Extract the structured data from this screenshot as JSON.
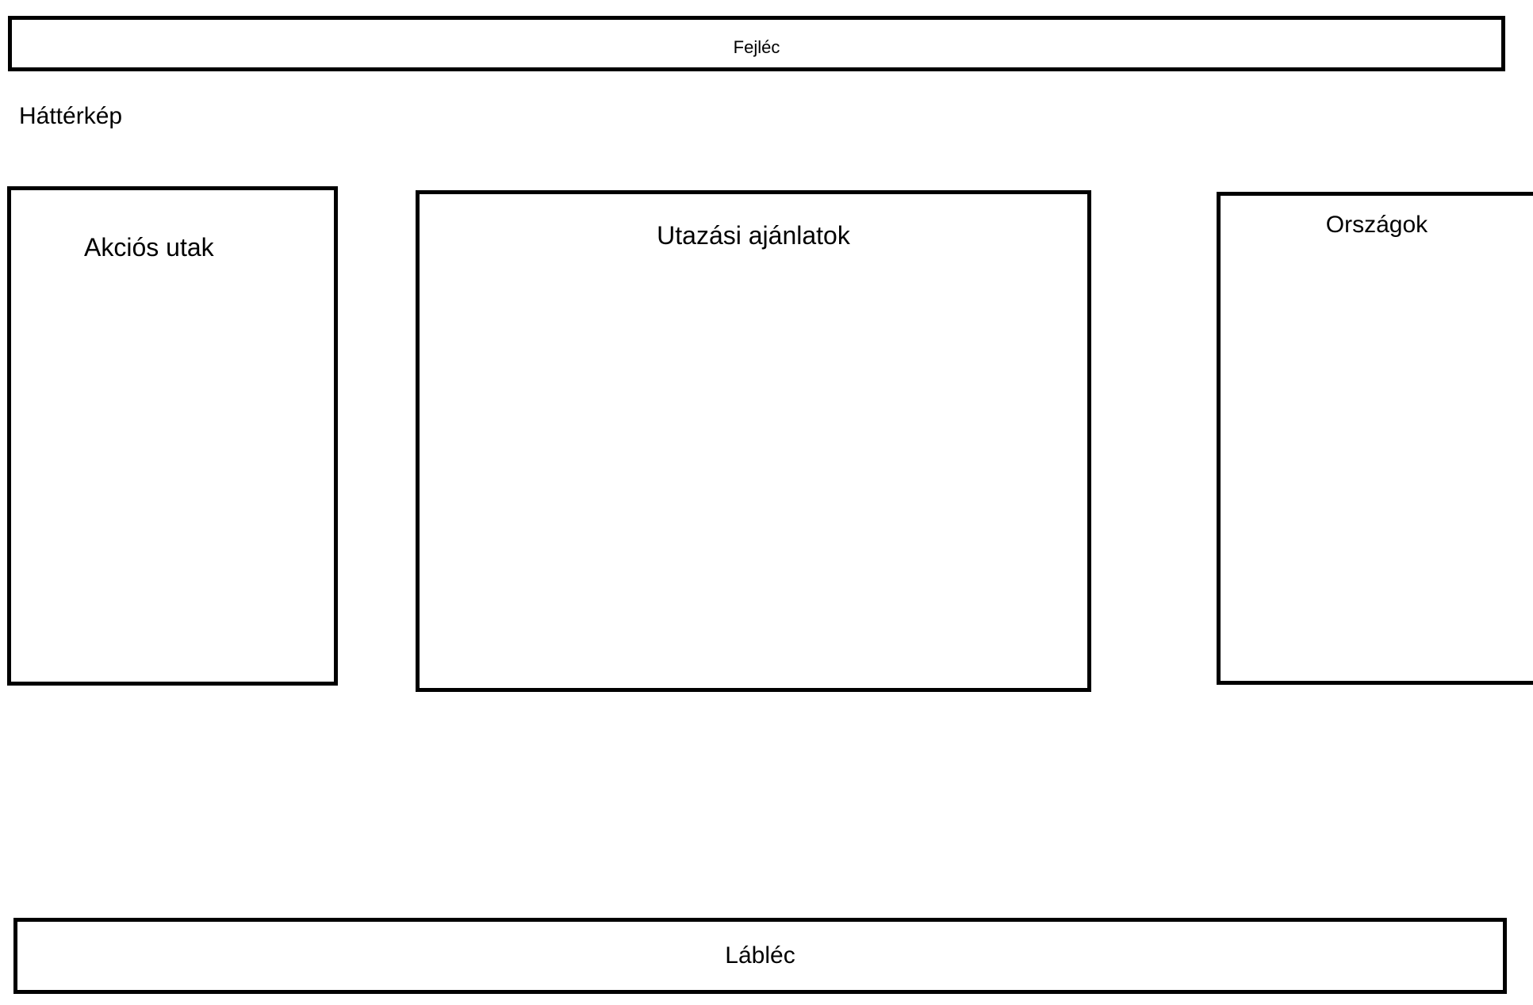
{
  "header": {
    "label": "Fejléc"
  },
  "background": {
    "label": "Háttérkép"
  },
  "sections": {
    "left": {
      "label": "Akciós utak"
    },
    "center": {
      "label": "Utazási ajánlatok"
    },
    "right": {
      "label": "Országok"
    }
  },
  "footer": {
    "label": "Lábléc"
  },
  "colors": {
    "border": "#000000",
    "background": "#ffffff",
    "text": "#000000"
  }
}
